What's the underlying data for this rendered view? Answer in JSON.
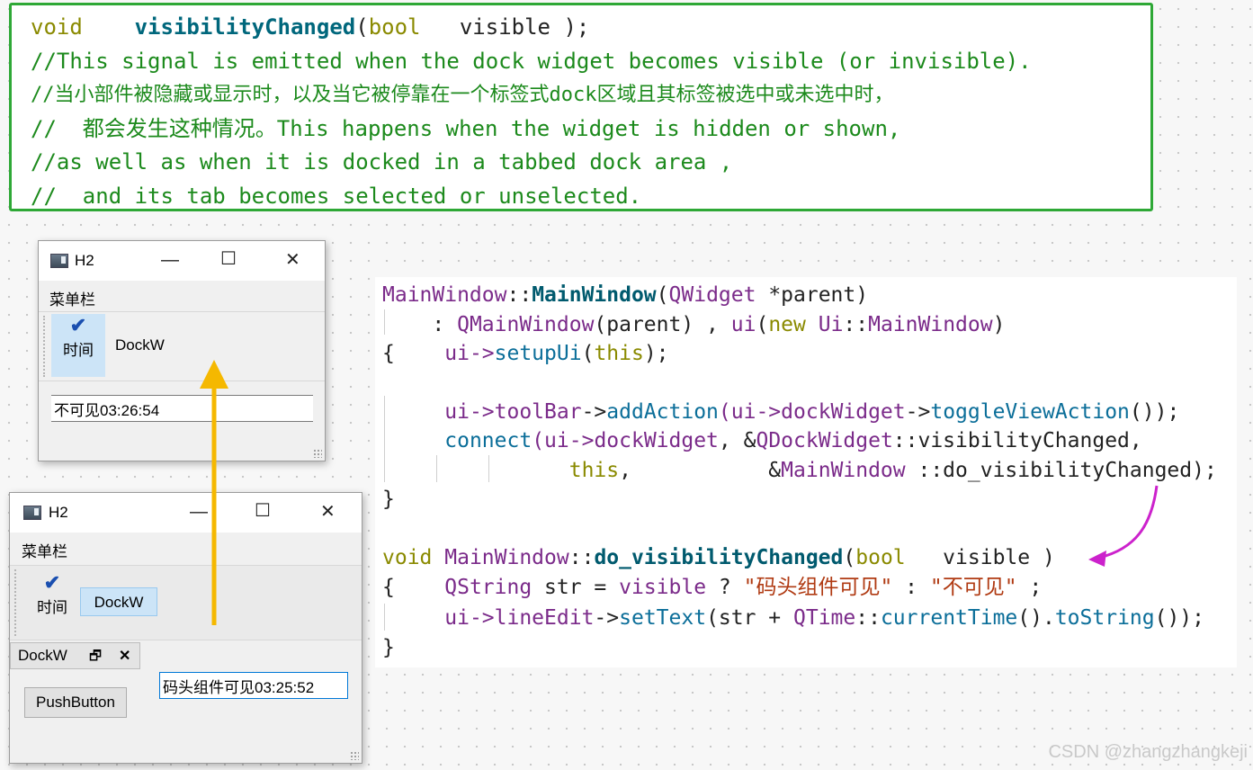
{
  "note": {
    "line1": {
      "kw": "void",
      "fn": "visibilityChanged",
      "paren_open": "(",
      "type": "bool",
      "rest": "visible );"
    },
    "lines": [
      "//This signal is emitted when the dock widget becomes visible (or invisible).",
      "//当小部件被隐藏或显示时，以及当它被停靠在一个标签式dock区域且其标签被选中或未选中时，",
      "//  都会发生这种情况。This happens when the widget is hidden or shown,",
      "//as well as when it is docked in a tabbed dock area ,",
      "//  and its tab becomes selected or unselected."
    ]
  },
  "window1": {
    "title": "H2",
    "minimize": "—",
    "maximize": "☐",
    "close": "✕",
    "menubar": "菜单栏",
    "action_label": "时间",
    "check_glyph": "✔",
    "dock_button": "DockW",
    "line_edit_value": "不可见03:26:54"
  },
  "window2": {
    "title": "H2",
    "minimize": "—",
    "maximize": "☐",
    "close": "✕",
    "menubar": "菜单栏",
    "action_label": "时间",
    "check_glyph": "✔",
    "dock_button": "DockW",
    "dock_title": "DockW",
    "dock_float": "🗗",
    "dock_close": "✕",
    "push_button": "PushButton",
    "line_edit_value": "码头组件可见03:25:52"
  },
  "code": {
    "l1": {
      "a": "MainWindow",
      "b": "::",
      "c": "MainWindow",
      "d": "(",
      "e": "QWidget",
      "f": " *parent)"
    },
    "l2": {
      "a": ": ",
      "b": "QMainWindow",
      "c": "(parent) , ",
      "d": "ui",
      "e": "(",
      "f": "new",
      "g": " ",
      "h": "Ui",
      "i": "::",
      "j": "MainWindow",
      "k": ")"
    },
    "l3": {
      "a": "{",
      "b": "ui->",
      "c": "setupUi",
      "d": "(",
      "e": "this",
      "f": ");"
    },
    "l4": {
      "a": "ui->",
      "b": "toolBar",
      "c": "->",
      "d": "addAction",
      "e": "(ui->",
      "f": "dockWidget",
      "g": "->",
      "h": "toggleViewAction",
      "i": "());"
    },
    "l5": {
      "a": "connect",
      "b": "(ui->",
      "c": "dockWidget",
      "d": ", &",
      "e": "QDockWidget",
      "f": "::visibilityChanged,"
    },
    "l6": {
      "a": "this",
      "b": ",",
      "c": "&",
      "d": "MainWindow",
      "e": " ::do_visibilityChanged);"
    },
    "l7": {
      "a": "}"
    },
    "l8": {
      "a": "void",
      "b": " ",
      "c": "MainWindow",
      "d": "::",
      "e": "do_visibilityChanged",
      "f": "(",
      "g": "bool",
      "h": "   visible )"
    },
    "l9": {
      "a": "{",
      "b": "QString",
      "c": " str = ",
      "d": "visible",
      "e": " ? ",
      "f": "\"码头组件可见\"",
      "g": " : ",
      "h": "\"不可见\"",
      "i": " ;"
    },
    "l10": {
      "a": "ui->",
      "b": "lineEdit",
      "c": "->",
      "d": "setText",
      "e": "(str + ",
      "f": "QTime",
      "g": "::",
      "h": "currentTime",
      "i": "().",
      "j": "toString",
      "k": "());"
    },
    "l11": {
      "a": "}"
    }
  },
  "colors": {
    "green_border": "#2ea836",
    "orange_arrow": "#f5b800",
    "magenta_arrow": "#cc22cc",
    "dock_highlight": "#cce4f7"
  },
  "watermark": "CSDN @zhangzhangkeji"
}
